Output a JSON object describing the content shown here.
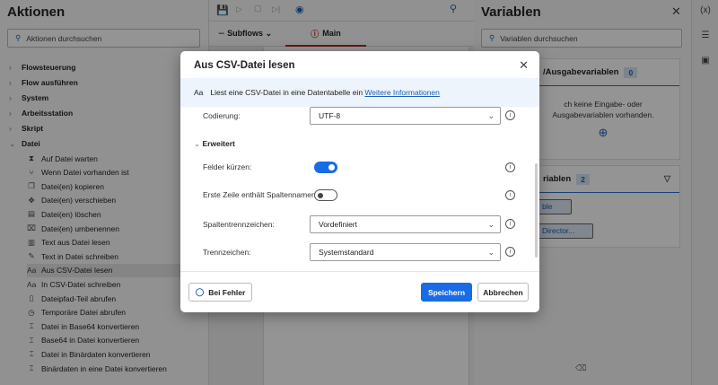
{
  "actions_panel": {
    "title": "Aktionen",
    "search_placeholder": "Aktionen durchsuchen",
    "categories": [
      {
        "label": "Flowsteuerung",
        "expanded": false
      },
      {
        "label": "Flow ausführen",
        "expanded": false
      },
      {
        "label": "System",
        "expanded": false
      },
      {
        "label": "Arbeitsstation",
        "expanded": false
      },
      {
        "label": "Skript",
        "expanded": false
      },
      {
        "label": "Datei",
        "expanded": true
      }
    ],
    "file_actions": [
      {
        "label": "Auf Datei warten",
        "icon": "hourglass-icon"
      },
      {
        "label": "Wenn Datei vorhanden ist",
        "icon": "branch-icon"
      },
      {
        "label": "Datei(en) kopieren",
        "icon": "copy-icon"
      },
      {
        "label": "Datei(en) verschieben",
        "icon": "move-icon"
      },
      {
        "label": "Datei(en) löschen",
        "icon": "delete-icon"
      },
      {
        "label": "Datei(en) umbenennen",
        "icon": "rename-icon"
      },
      {
        "label": "Text aus Datei lesen",
        "icon": "read-text-icon"
      },
      {
        "label": "Text in Datei schreiben",
        "icon": "write-text-icon"
      },
      {
        "label": "Aus CSV-Datei lesen",
        "icon": "text-icon",
        "selected": true
      },
      {
        "label": "In CSV-Datei schreiben",
        "icon": "text-icon"
      },
      {
        "label": "Dateipfad-Teil abrufen",
        "icon": "file-path-icon"
      },
      {
        "label": "Temporäre Datei abrufen",
        "icon": "temp-file-icon"
      },
      {
        "label": "Datei in Base64 konvertieren",
        "icon": "convert-icon"
      },
      {
        "label": "Base64 in Datei konvertieren",
        "icon": "convert-icon"
      },
      {
        "label": "Datei in Binärdaten konvertieren",
        "icon": "convert-icon"
      },
      {
        "label": "Binärdaten in eine Datei konvertieren",
        "icon": "convert-icon"
      }
    ]
  },
  "designer": {
    "subflows_label": "Subflows",
    "main_tab": "Main"
  },
  "variables_panel": {
    "title": "Variablen",
    "search_placeholder": "Variablen durchsuchen",
    "io_header": "/Ausgabevariablen",
    "io_count": "0",
    "io_empty": "ch keine Eingabe- oder Ausgabevariablen vorhanden.",
    "flow_header": "riablen",
    "flow_count": "2",
    "vars": [
      "ble",
      "Director..."
    ]
  },
  "side_strip": {
    "variables_icon_label": "(x)"
  },
  "dialog": {
    "title": "Aus CSV-Datei lesen",
    "icon_label": "Aa",
    "description": "Liest eine CSV-Datei in eine Datentabelle ein",
    "link": "Weitere Informationen",
    "encoding_label": "Codierung:",
    "encoding_value": "UTF-8",
    "advanced_label": "Erweitert",
    "trim_label": "Felder kürzen:",
    "trim_on": true,
    "header_row_label": "Erste Zeile enthält Spaltennamen:",
    "header_row_on": false,
    "column_sep_label": "Spaltentrennzeichen:",
    "column_sep_value": "Vordefiniert",
    "sep_label": "Trennzeichen:",
    "sep_value": "Systemstandard",
    "on_error": "Bei Fehler",
    "save": "Speichern",
    "cancel": "Abbrechen"
  },
  "colors": {
    "accent": "#1a6be6",
    "link": "#1a5fb4"
  }
}
